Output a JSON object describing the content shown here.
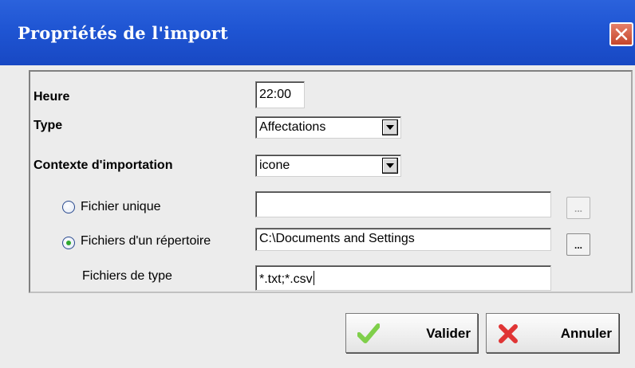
{
  "window": {
    "title": "Propriétés de l'import",
    "close_icon": "close-icon"
  },
  "form": {
    "heure": {
      "label": "Heure",
      "value": "22:00"
    },
    "type": {
      "label": "Type",
      "value": "Affectations"
    },
    "contexte": {
      "label": "Contexte d'importation",
      "value": "icone"
    },
    "fichier_unique": {
      "label": "Fichier unique",
      "value": "",
      "selected": false,
      "browse": "..."
    },
    "fichiers_repertoire": {
      "label": "Fichiers d'un répertoire",
      "value": "C:\\Documents and Settings",
      "selected": true,
      "browse": "..."
    },
    "fichiers_type": {
      "label": "Fichiers de type",
      "value": "*.txt;*.csv"
    }
  },
  "buttons": {
    "valider": "Valider",
    "annuler": "Annuler"
  },
  "colors": {
    "titlebar": "#1f55d3",
    "valider_icon": "#7fcf4a",
    "annuler_icon": "#e03535"
  }
}
